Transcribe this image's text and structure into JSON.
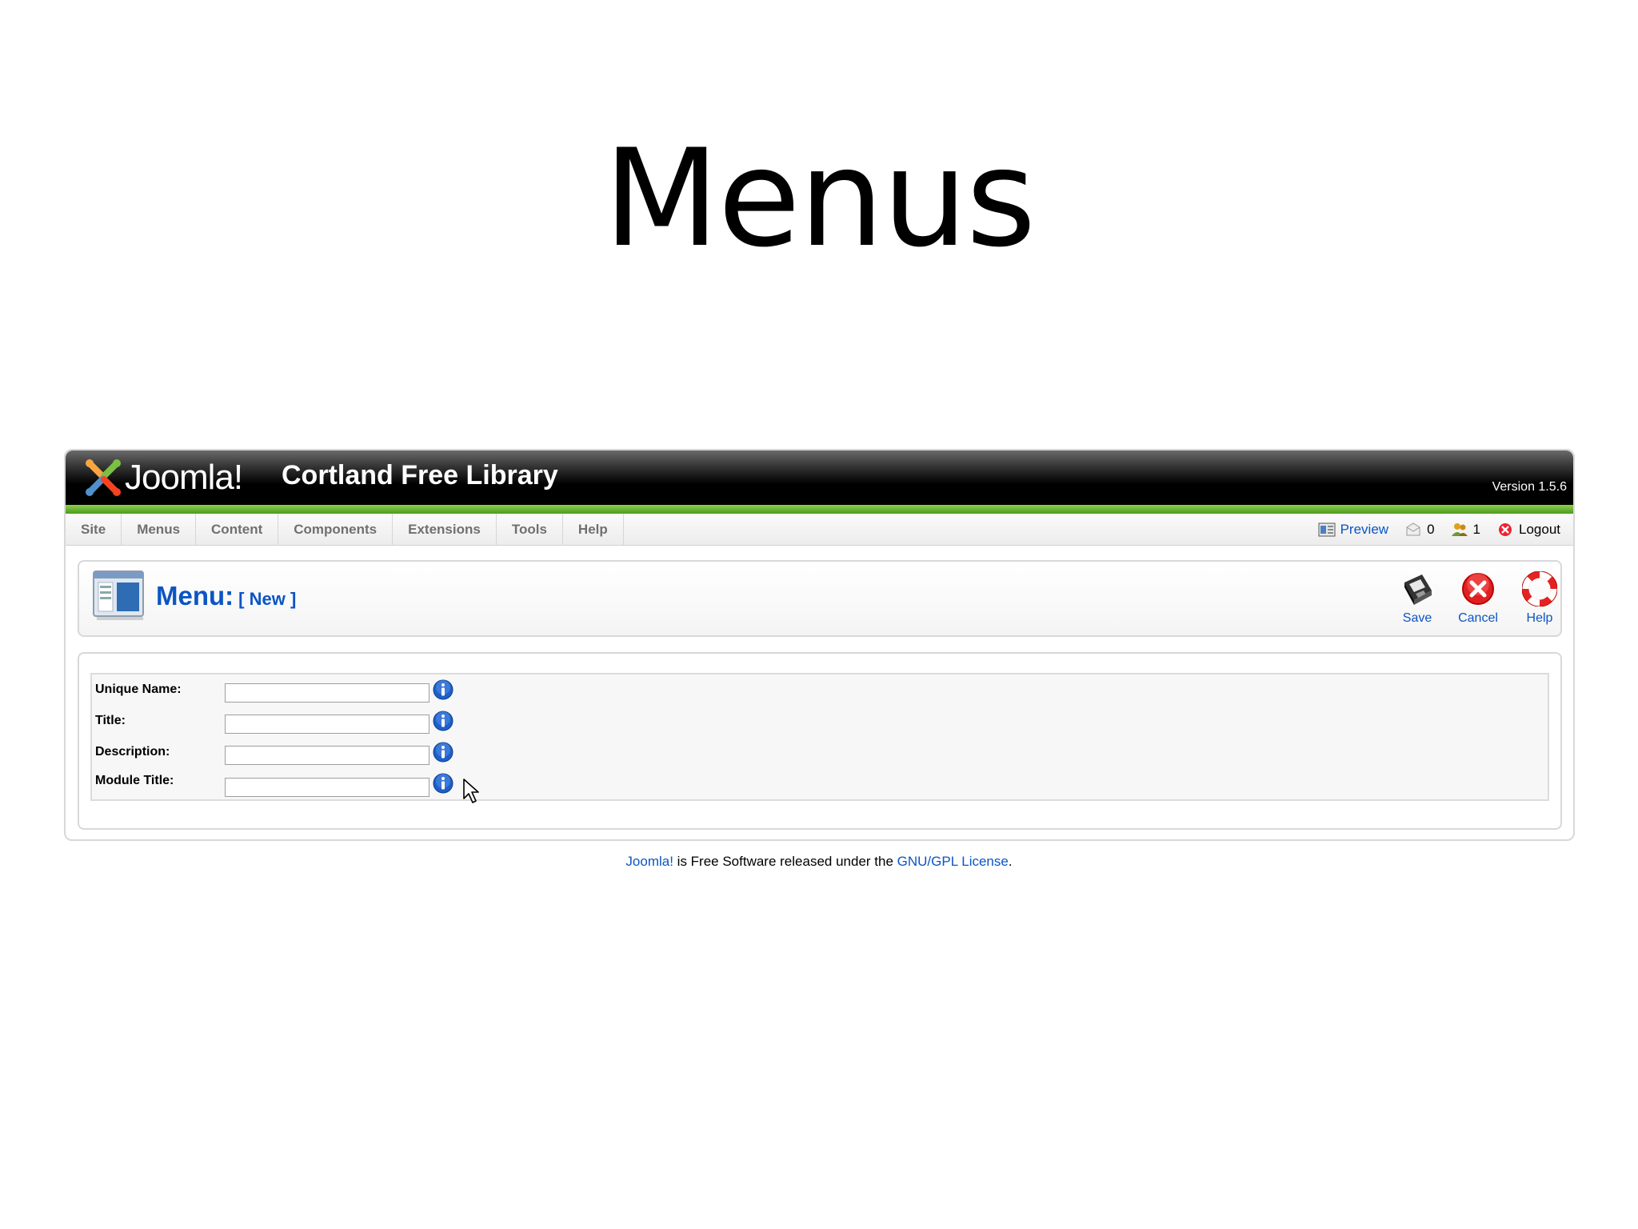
{
  "slide": {
    "title": "Menus"
  },
  "header": {
    "logo_text": "Joomla!",
    "site_name": "Cortland Free Library",
    "version": "Version 1.5.6"
  },
  "menubar": {
    "items": [
      {
        "label": "Site"
      },
      {
        "label": "Menus"
      },
      {
        "label": "Content"
      },
      {
        "label": "Components"
      },
      {
        "label": "Extensions"
      },
      {
        "label": "Tools"
      },
      {
        "label": "Help"
      }
    ],
    "status": {
      "preview_label": "Preview",
      "messages_count": "0",
      "users_count": "1",
      "logout_label": "Logout"
    }
  },
  "toolbar": {
    "title": "Menu:",
    "subtitle": "[ New ]",
    "save_label": "Save",
    "cancel_label": "Cancel",
    "help_label": "Help"
  },
  "form": {
    "fields": [
      {
        "label": "Unique Name:",
        "value": ""
      },
      {
        "label": "Title:",
        "value": ""
      },
      {
        "label": "Description:",
        "value": ""
      },
      {
        "label": "Module Title:",
        "value": ""
      }
    ]
  },
  "footer": {
    "joomla_link": "Joomla!",
    "middle_text": " is Free Software released under the ",
    "license_link": "GNU/GPL License",
    "end_text": "."
  }
}
